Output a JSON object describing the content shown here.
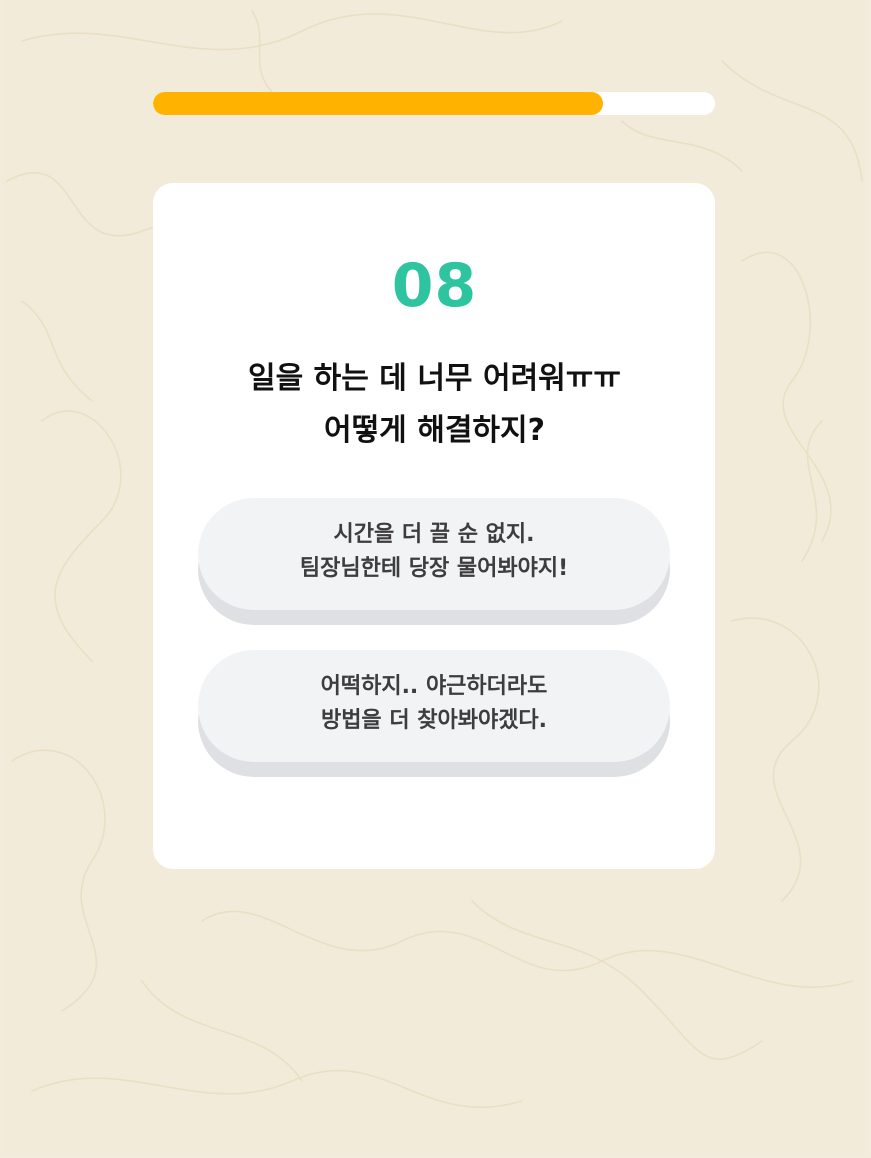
{
  "progress": {
    "value_percent": 80,
    "fill_color": "#ffb200",
    "track_color": "#ffffff"
  },
  "question": {
    "number": "08",
    "number_color": "#2ec4a0",
    "lines": [
      "일을 하는 데 너무 어려워ㅠㅠ",
      "어떻게 해결하지?"
    ]
  },
  "answers": [
    {
      "lines": [
        "시간을 더 끌 순 없지.",
        "팀장님한테 당장 물어봐야지!"
      ]
    },
    {
      "lines": [
        "어떡하지.. 야근하더라도",
        "방법을 더 찾아봐야겠다."
      ]
    }
  ],
  "background": {
    "paper_color": "#f2ebda",
    "fiber_color": "#e4d6b2"
  }
}
